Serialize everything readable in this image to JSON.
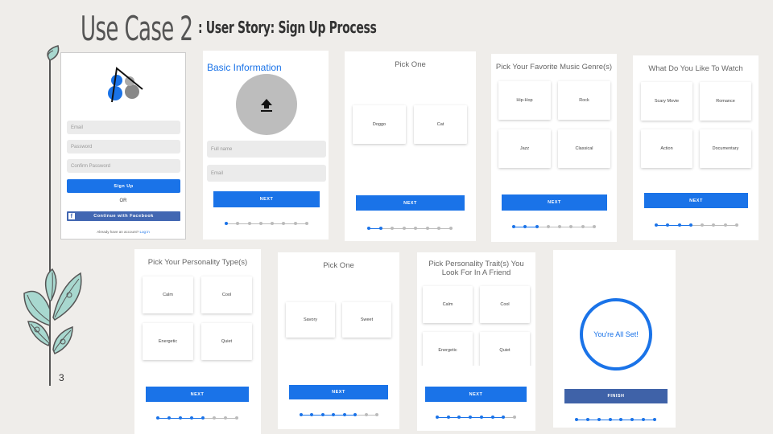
{
  "header": {
    "title": "Use Case 2",
    "subtitle": ": User Story: Sign Up Process"
  },
  "slide_number": "3",
  "signup": {
    "email_placeholder": "Email",
    "password_placeholder": "Password",
    "confirm_placeholder": "Confirm Password",
    "signup_label": "Sign Up",
    "or_label": "OR",
    "facebook_label": "Continue with Facebook",
    "facebook_glyph": "f",
    "have_account": "Already have an account?",
    "login_label": "Log in"
  },
  "basic_info": {
    "title": "Basic Information",
    "fullname_placeholder": "Full name",
    "email_placeholder": "Email",
    "next_label": "NEXT",
    "progress": 1
  },
  "pick_pet": {
    "title": "Pick One",
    "options": [
      "Doggo",
      "Cat"
    ],
    "next_label": "NEXT",
    "progress": 2
  },
  "music": {
    "title": "Pick Your Favorite Music Genre(s)",
    "options": [
      "Hip-Hop",
      "Rock",
      "Jazz",
      "Classical"
    ],
    "next_label": "NEXT",
    "progress": 3
  },
  "watch": {
    "title": "What Do You Like To Watch",
    "options": [
      "Scary Movie",
      "Romance",
      "Action",
      "Documentary"
    ],
    "next_label": "NEXT",
    "progress": 4
  },
  "personality": {
    "title": "Pick Your Personality Type(s)",
    "options": [
      "Calm",
      "Cool",
      "Energetic",
      "Quiet"
    ],
    "next_label": "NEXT",
    "progress": 5
  },
  "taste": {
    "title": "Pick One",
    "options": [
      "Savory",
      "Sweet"
    ],
    "next_label": "NEXT",
    "progress": 6
  },
  "friend_traits": {
    "title": "Pick Personality Trait(s) You Look For In A Friend",
    "options": [
      "Calm",
      "Cool",
      "Energetic",
      "Quiet"
    ],
    "next_label": "NEXT",
    "progress": 7
  },
  "done": {
    "message": "You're All Set!",
    "finish_label": "FINISH",
    "progress": 8
  },
  "progress_total": 8,
  "colors": {
    "accent": "#1a73e8",
    "facebook": "#4267b2",
    "finish": "#3f62a8",
    "plant_leaf": "#a8d8cf"
  },
  "icons": [
    "upload-icon",
    "facebook-icon",
    "app-logo",
    "plant-decoration"
  ]
}
